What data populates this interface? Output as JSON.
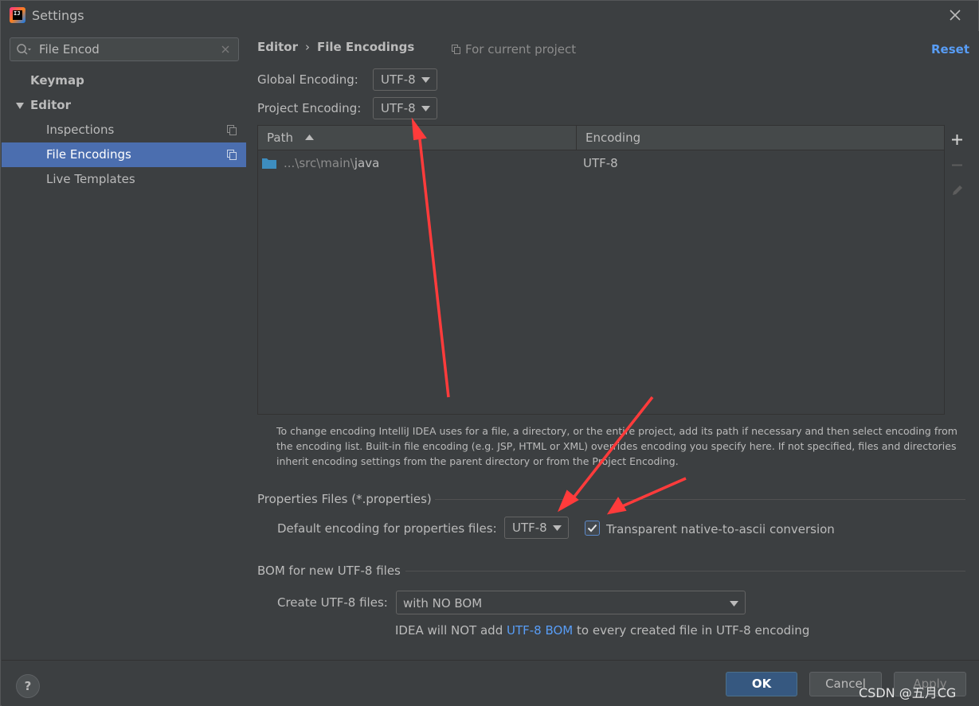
{
  "window": {
    "title": "Settings"
  },
  "sidebar": {
    "search_value": "File Encod",
    "items": [
      {
        "label": "Keymap"
      },
      {
        "label": "Editor"
      },
      {
        "label": "Inspections"
      },
      {
        "label": "File Encodings"
      },
      {
        "label": "Live Templates"
      }
    ]
  },
  "header": {
    "breadcrumb": [
      "Editor",
      "File Encodings"
    ],
    "separator": "›",
    "scope": "For current project",
    "reset": "Reset"
  },
  "global_encoding": {
    "label": "Global Encoding:",
    "value": "UTF-8"
  },
  "project_encoding": {
    "label": "Project Encoding:",
    "value": "UTF-8"
  },
  "table": {
    "columns": [
      "Path",
      "Encoding"
    ],
    "rows": [
      {
        "path_prefix": "...\\src\\main\\",
        "path_name": "java",
        "encoding": "UTF-8"
      }
    ]
  },
  "hint": "To change encoding IntelliJ IDEA uses for a file, a directory, or the entire project, add its path if necessary and then select encoding from the encoding list. Built-in file encoding (e.g. JSP, HTML or XML) overrides encoding you specify here. If not specified, files and directories inherit encoding settings from the parent directory or from the Project Encoding.",
  "properties": {
    "section_title": "Properties Files (*.properties)",
    "default_label": "Default encoding for properties files:",
    "default_value": "UTF-8",
    "checkbox_label": "Transparent native-to-ascii conversion",
    "checkbox_checked": true
  },
  "bom": {
    "section_title": "BOM for new UTF-8 files",
    "create_label": "Create UTF-8 files:",
    "create_value": "with NO BOM",
    "note_before": "IDEA will NOT add ",
    "note_link": "UTF-8 BOM",
    "note_after": " to every created file in UTF-8 encoding"
  },
  "footer": {
    "help": "?",
    "ok": "OK",
    "cancel": "Cancel",
    "apply": "Apply"
  },
  "watermark": "CSDN @五月CG",
  "colors": {
    "accent": "#4b6eaf",
    "link": "#589df6",
    "annotation_arrow": "#ff3b3b"
  }
}
